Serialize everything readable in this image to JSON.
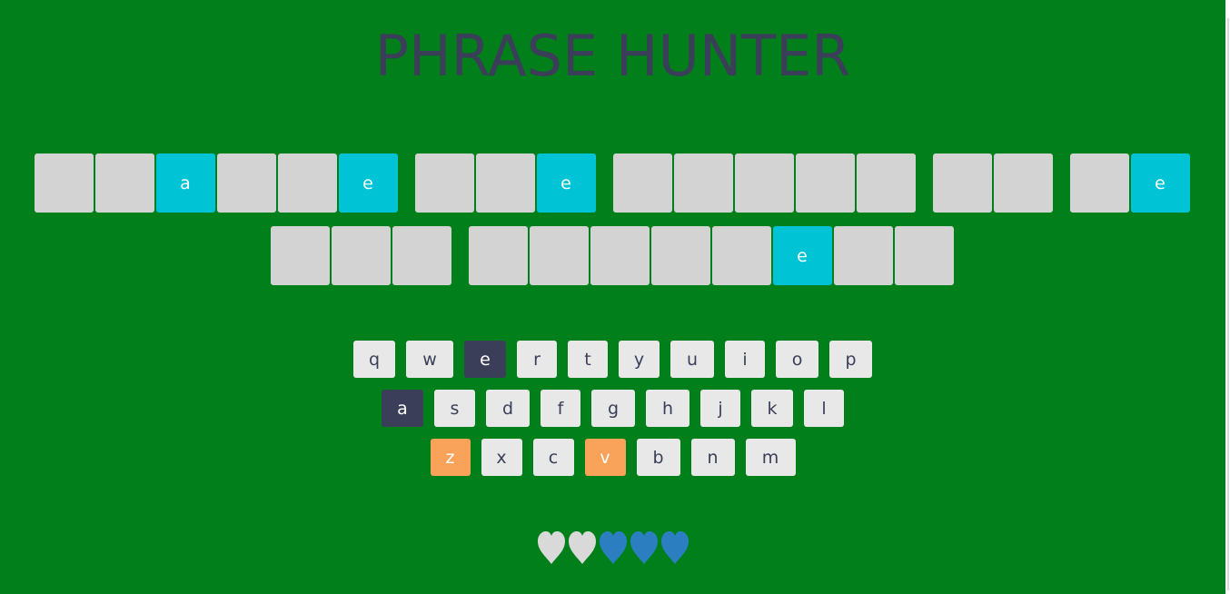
{
  "title": "PHRASE HUNTER",
  "colors": {
    "background": "#007f1a",
    "tile_hidden": "#d3d3d3",
    "tile_shown": "#00c3d6",
    "key_default": "#e8e8e8",
    "key_chosen": "#3a3e58",
    "key_wrong": "#f9a25a",
    "heart_lost": "#d9d9d9",
    "heart_live": "#2b7fc0"
  },
  "phrase": {
    "rows": [
      [
        {
          "letter": "",
          "shown": false
        },
        {
          "letter": "",
          "shown": false
        },
        {
          "letter": "a",
          "shown": true
        },
        {
          "letter": "",
          "shown": false
        },
        {
          "letter": "",
          "shown": false
        },
        {
          "letter": "e",
          "shown": true
        },
        {
          "space": true
        },
        {
          "letter": "",
          "shown": false
        },
        {
          "letter": "",
          "shown": false
        },
        {
          "letter": "e",
          "shown": true
        },
        {
          "space": true
        },
        {
          "letter": "",
          "shown": false
        },
        {
          "letter": "",
          "shown": false
        },
        {
          "letter": "",
          "shown": false
        },
        {
          "letter": "",
          "shown": false
        },
        {
          "letter": "",
          "shown": false
        },
        {
          "space": true
        },
        {
          "letter": "",
          "shown": false
        },
        {
          "letter": "",
          "shown": false
        },
        {
          "space": true
        },
        {
          "letter": "",
          "shown": false
        },
        {
          "letter": "e",
          "shown": true
        }
      ],
      [
        {
          "letter": "",
          "shown": false
        },
        {
          "letter": "",
          "shown": false
        },
        {
          "letter": "",
          "shown": false
        },
        {
          "space": true
        },
        {
          "letter": "",
          "shown": false
        },
        {
          "letter": "",
          "shown": false
        },
        {
          "letter": "",
          "shown": false
        },
        {
          "letter": "",
          "shown": false
        },
        {
          "letter": "",
          "shown": false
        },
        {
          "letter": "e",
          "shown": true
        },
        {
          "letter": "",
          "shown": false
        },
        {
          "letter": "",
          "shown": false
        }
      ]
    ]
  },
  "keyboard": {
    "rows": [
      [
        {
          "label": "q",
          "state": "default"
        },
        {
          "label": "w",
          "state": "default"
        },
        {
          "label": "e",
          "state": "chosen"
        },
        {
          "label": "r",
          "state": "default"
        },
        {
          "label": "t",
          "state": "default"
        },
        {
          "label": "y",
          "state": "default"
        },
        {
          "label": "u",
          "state": "default"
        },
        {
          "label": "i",
          "state": "default"
        },
        {
          "label": "o",
          "state": "default"
        },
        {
          "label": "p",
          "state": "default"
        }
      ],
      [
        {
          "label": "a",
          "state": "chosen"
        },
        {
          "label": "s",
          "state": "default"
        },
        {
          "label": "d",
          "state": "default"
        },
        {
          "label": "f",
          "state": "default"
        },
        {
          "label": "g",
          "state": "default"
        },
        {
          "label": "h",
          "state": "default"
        },
        {
          "label": "j",
          "state": "default"
        },
        {
          "label": "k",
          "state": "default"
        },
        {
          "label": "l",
          "state": "default"
        }
      ],
      [
        {
          "label": "z",
          "state": "wrong"
        },
        {
          "label": "x",
          "state": "default"
        },
        {
          "label": "c",
          "state": "default"
        },
        {
          "label": "v",
          "state": "wrong"
        },
        {
          "label": "b",
          "state": "default"
        },
        {
          "label": "n",
          "state": "default"
        },
        {
          "label": "m",
          "state": "default"
        }
      ]
    ]
  },
  "lives": {
    "hearts": [
      {
        "icon": "heart-icon",
        "state": "lost"
      },
      {
        "icon": "heart-icon",
        "state": "lost"
      },
      {
        "icon": "heart-icon",
        "state": "live"
      },
      {
        "icon": "heart-icon",
        "state": "live"
      },
      {
        "icon": "heart-icon",
        "state": "live"
      }
    ]
  }
}
